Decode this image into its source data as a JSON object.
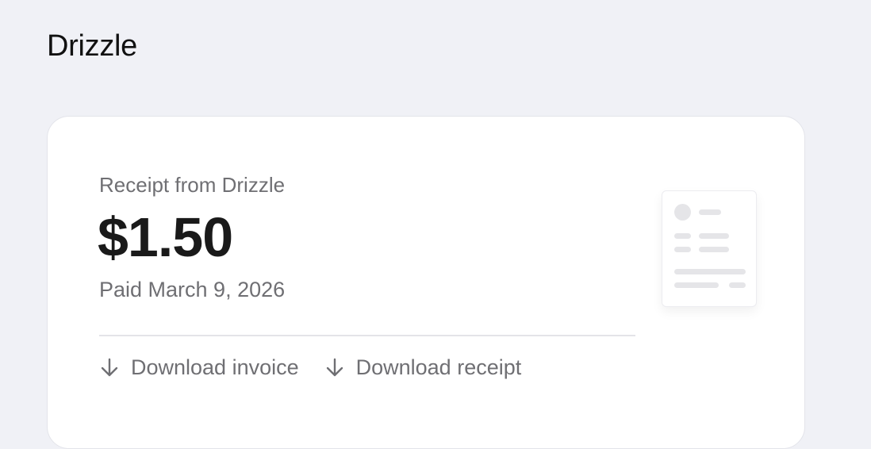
{
  "brand": {
    "name": "Drizzle"
  },
  "receipt": {
    "subtitle": "Receipt from Drizzle",
    "amount": "$1.50",
    "paid_date": "Paid March 9, 2026"
  },
  "actions": [
    {
      "label": "Download invoice",
      "icon": "arrow-down-icon"
    },
    {
      "label": "Download receipt",
      "icon": "arrow-down-icon"
    }
  ],
  "illustration": {
    "icon": "receipt-document-icon"
  },
  "colors": {
    "page_background": "#f0f1f6",
    "card_background": "#ffffff",
    "primary_text": "#1a1a1a",
    "secondary_text": "#6f6f73",
    "divider": "#e4e4e8"
  }
}
